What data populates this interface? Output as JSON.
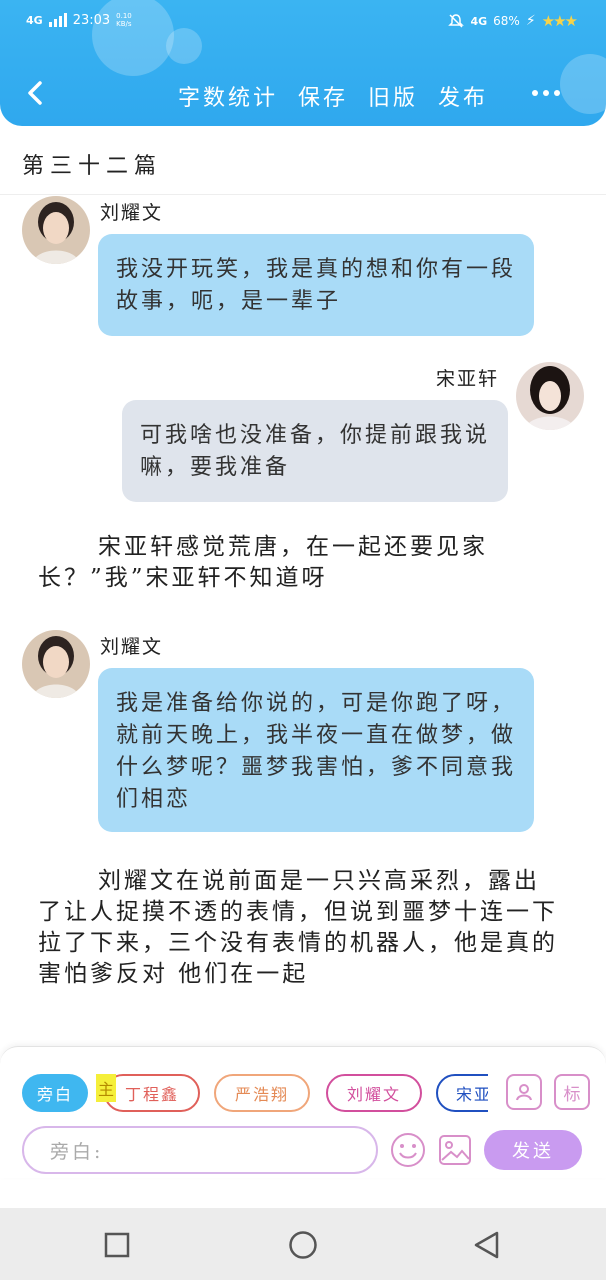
{
  "status_bar": {
    "network_left": "4G",
    "time": "23:03",
    "speed": "0.10 KB/s",
    "network_right": "4G",
    "battery": "68%"
  },
  "header": {
    "actions": [
      "字数统计",
      "保存",
      "旧版",
      "发布"
    ]
  },
  "chapter": {
    "title": "第三十二篇"
  },
  "messages": [
    {
      "speaker": "刘耀文",
      "text": "我没开玩笑，我是真的想和你有一段故事，呃，是一辈子"
    },
    {
      "speaker": "宋亚轩",
      "text": "可我啥也没准备，你提前跟我说嘛，要我准备"
    },
    {
      "narration": "宋亚轩感觉荒唐，在一起还要见家长？”我”宋亚轩不知道呀"
    },
    {
      "speaker": "刘耀文",
      "text": "我是准备给你说的，可是你跑了呀，就前天晚上，我半夜一直在做梦，做什么梦呢？噩梦我害怕，爹不同意我们相恋"
    },
    {
      "narration": "刘耀文在说前面是一只兴高采烈，露出了让人捉摸不透的表情，但说到噩梦十连一下拉了下来，三个没有表情的机器人，他是真的害怕爹反对 他们在一起"
    }
  ],
  "composer": {
    "roles": [
      "旁白",
      "丁程鑫",
      "严浩翔",
      "刘耀文",
      "宋亚轩"
    ],
    "main_tag": "主",
    "mark_button": "标",
    "input_placeholder": "旁白:",
    "send_label": "发送"
  },
  "colors": {
    "header": "#2fa8ee",
    "bubble_blue": "#a9dbf7",
    "bubble_gray": "#dfe4ec",
    "send": "#c99bf0"
  }
}
